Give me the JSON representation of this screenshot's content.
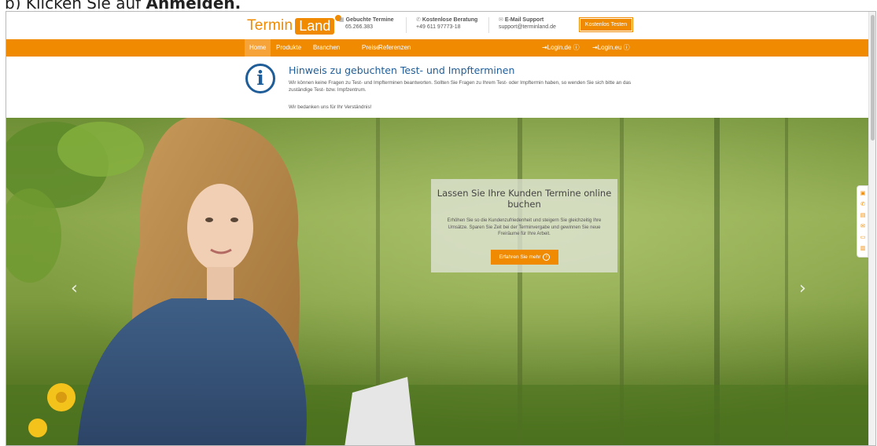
{
  "caption": {
    "prefix": "b) Klicken Sie auf ",
    "bold": "Anmelden."
  },
  "logo": {
    "part1": "Termin",
    "part2": "Land"
  },
  "header": {
    "booked": {
      "title": "Gebuchte Termine",
      "value": "65.266.383",
      "icon": "calendar-icon"
    },
    "consult": {
      "title": "Kostenlose Beratung",
      "value": "+49 611 97773-18",
      "icon": "phone-icon"
    },
    "support": {
      "title": "E-Mail Support",
      "value": "support@terminland.de",
      "icon": "mail-icon"
    },
    "trial_button": "Kostenlos Testen"
  },
  "nav": {
    "items": [
      "Home",
      "Produkte",
      "Branchen",
      "Preise",
      "Referenzen"
    ],
    "login_de": "Login.de",
    "login_eu": "Login.eu"
  },
  "notice": {
    "title": "Hinweis zu gebuchten Test- und Impfterminen",
    "text": "Wir können keine Fragen zu Test- und Impfterminen beantworten. Sollten Sie Fragen zu Ihrem Test- oder Impftermin haben, so wenden Sie sich bitte an das zuständige Test- bzw. Impfzentrum.",
    "thanks": "Wir bedanken uns für Ihr Verständnis!"
  },
  "hero": {
    "title": "Lassen Sie Ihre Kunden Termine online buchen",
    "text": "Erhöhen Sie so die Kundenzufriedenheit und steigern Sie gleichzeitig Ihre Umsätze. Sparen Sie Zeit bei der Terminvergabe und gewinnen Sie neue Freiräume für Ihre Arbeit.",
    "button": "Erfahren Sie mehr"
  },
  "side_icons": [
    "gift-icon",
    "phone-icon",
    "print-icon",
    "mail-icon",
    "monitor-icon",
    "document-icon"
  ],
  "colors": {
    "accent": "#f08a00",
    "brand_blue": "#1f5d98"
  }
}
